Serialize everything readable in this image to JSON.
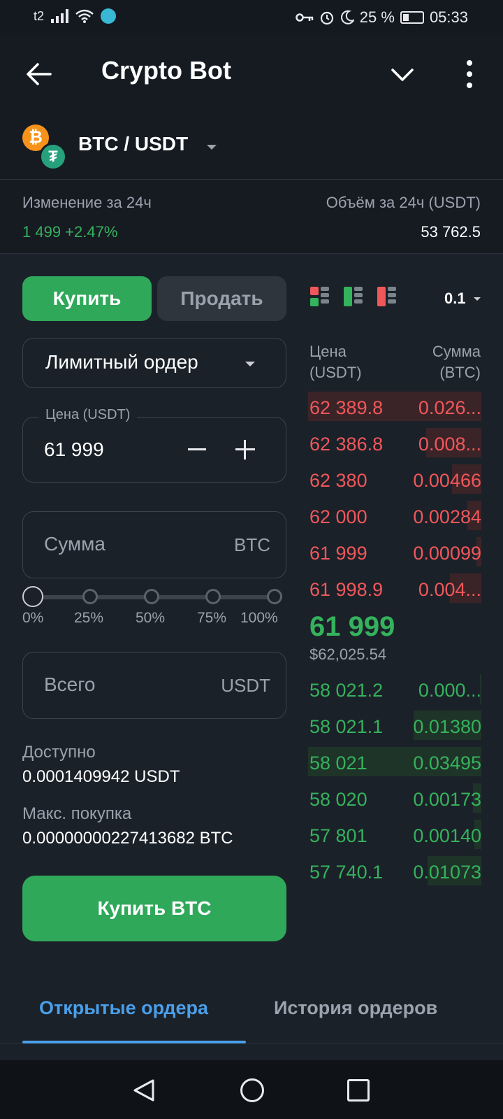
{
  "status": {
    "carrier": "t2",
    "battery": "25 %",
    "time": "05:33"
  },
  "header": {
    "title": "Crypto Bot",
    "icons": [
      "back-arrow-icon",
      "chevron-down-icon",
      "more-vertical-icon"
    ]
  },
  "pair": {
    "label": "BTC / USDT",
    "base_coin": "BTC",
    "quote_coin": "USDT"
  },
  "stats": {
    "change_label": "Изменение за 24ч",
    "change_value": "1 499 +2.47%",
    "volume_label": "Объём за 24ч (USDT)",
    "volume_value": "53 762.5"
  },
  "form": {
    "buy_tab": "Купить",
    "sell_tab": "Продать",
    "order_type": "Лимитный ордер",
    "price_label": "Цена (USDT)",
    "price_value": "61 999",
    "amount_placeholder": "Сумма",
    "amount_unit": "BTC",
    "slider_marks": [
      "0%",
      "25%",
      "50%",
      "75%",
      "100%"
    ],
    "slider_value": 0,
    "total_placeholder": "Всего",
    "total_unit": "USDT",
    "available_label": "Доступно",
    "available_value": "0.0001409942 USDT",
    "max_buy_label": "Макс. покупка",
    "max_buy_value": "0.00000000227413682 BTC",
    "submit_label": "Купить BTC"
  },
  "orderbook": {
    "precision": "0.1",
    "price_header": "Цена\n(USDT)",
    "size_header": "Сумма\n(BTC)",
    "asks": [
      {
        "price": "62 389.8",
        "size": "0.026...",
        "depth": 1.0
      },
      {
        "price": "62 386.8",
        "size": "0.008...",
        "depth": 0.32
      },
      {
        "price": "62 380",
        "size": "0.00466",
        "depth": 0.17
      },
      {
        "price": "62 000",
        "size": "0.00284",
        "depth": 0.08
      },
      {
        "price": "61 999",
        "size": "0.00099",
        "depth": 0.03
      },
      {
        "price": "61 998.9",
        "size": "0.004...",
        "depth": 0.18
      }
    ],
    "last_price": "61 999",
    "last_price_usd": "$62,025.54",
    "bids": [
      {
        "price": "58 021.2",
        "size": "0.000...",
        "depth": 0.01
      },
      {
        "price": "58 021.1",
        "size": "0.01380",
        "depth": 0.39
      },
      {
        "price": "58 021",
        "size": "0.03495",
        "depth": 1.0
      },
      {
        "price": "58 020",
        "size": "0.00173",
        "depth": 0.05
      },
      {
        "price": "57 801",
        "size": "0.00140",
        "depth": 0.04
      },
      {
        "price": "57 740.1",
        "size": "0.01073",
        "depth": 0.31
      }
    ]
  },
  "bottom_tabs": {
    "open_orders": "Открытые ордера",
    "order_history": "История ордеров"
  },
  "colors": {
    "buy": "#2fa85a",
    "ask": "#f0575a",
    "bid": "#34b25c",
    "accent": "#4a9fe8"
  }
}
